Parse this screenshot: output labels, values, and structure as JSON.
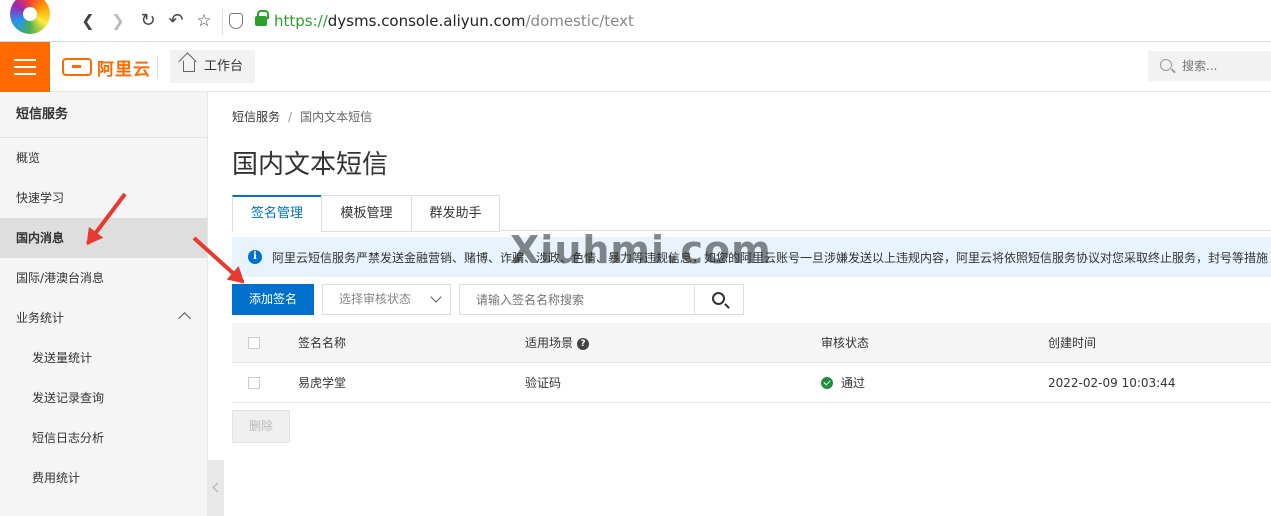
{
  "browser": {
    "url_protocol": "https://",
    "url_host": "dysms.console.aliyun.com",
    "url_path": "/domestic/text"
  },
  "topbar": {
    "brand": "阿里云",
    "workbench": "工作台",
    "search_placeholder": "搜索..."
  },
  "sidebar": {
    "title": "短信服务",
    "items": [
      {
        "label": "概览"
      },
      {
        "label": "快速学习"
      },
      {
        "label": "国内消息"
      },
      {
        "label": "国际/港澳台消息"
      },
      {
        "label": "业务统计"
      },
      {
        "label": "发送量统计"
      },
      {
        "label": "发送记录查询"
      },
      {
        "label": "短信日志分析"
      },
      {
        "label": "费用统计"
      }
    ]
  },
  "main": {
    "breadcrumb": [
      "短信服务",
      "国内文本短信"
    ],
    "breadcrumb_sep": "/",
    "page_title": "国内文本短信",
    "tabs": [
      {
        "label": "签名管理",
        "active": true
      },
      {
        "label": "模板管理",
        "active": false
      },
      {
        "label": "群发助手",
        "active": false
      }
    ],
    "notice": "阿里云短信服务严禁发送金融营销、赌博、诈骗、涉政、色情、暴力等违规信息，如您的阿里云账号一旦涉嫌发送以上违规内容，阿里云将依照短信服务协议对您采取终止服务，封号等措施",
    "add_button": "添加签名",
    "status_select": "选择审核状态",
    "search_placeholder": "请输入签名名称搜索",
    "table": {
      "headers": [
        "签名名称",
        "适用场景",
        "审核状态",
        "创建时间"
      ],
      "rows": [
        {
          "name": "易虎学堂",
          "scene": "验证码",
          "status": "通过",
          "created": "2022-02-09 10:03:44"
        }
      ]
    },
    "delete_button": "删除"
  },
  "watermark": "Xiuhmi.com",
  "colors": {
    "accent": "#0070cc",
    "brand": "#ff6a00",
    "annotation": "#e8392f",
    "success": "#1e8e3e"
  }
}
